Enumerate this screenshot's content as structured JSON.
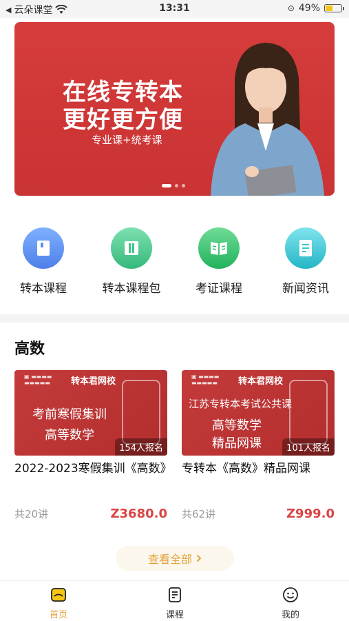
{
  "status_bar": {
    "carrier": "云朵课堂",
    "time": "13:31",
    "battery": "49%",
    "battery_level": 0.49
  },
  "banner": {
    "title_line1": "在线专转本",
    "title_line2": "更好更方便",
    "subtitle": "专业课+统考课",
    "slides": 3,
    "active_slide": 0
  },
  "quick_nav": [
    {
      "label": "转本课程",
      "icon": "book-icon",
      "color": "#5b8ef0"
    },
    {
      "label": "转本课程包",
      "icon": "package-icon",
      "color": "#3fc48c"
    },
    {
      "label": "考证课程",
      "icon": "open-book-icon",
      "color": "#2fc26b"
    },
    {
      "label": "新闻资讯",
      "icon": "document-icon",
      "color": "#36c6d3"
    }
  ],
  "section": {
    "title": "高数"
  },
  "courses": [
    {
      "brand": "转本君网校",
      "line1": "考前寒假集训",
      "line2": "高等数学",
      "enrolled": "154人报名",
      "title": "2022-2023寒假集训《高数》",
      "lessons": "共20讲",
      "price": "Z3680.0"
    },
    {
      "brand": "转本君网校",
      "line1": "江苏专转本考试公共课",
      "line2": "高等数学",
      "line3": "精品网课",
      "enrolled": "101人报名",
      "title": "专转本《高数》精品网课",
      "lessons": "共62讲",
      "price": "Z999.0"
    }
  ],
  "view_all": {
    "label": "查看全部",
    "icon": "chevron-right-icon"
  },
  "tab_bar": [
    {
      "label": "首页",
      "icon": "home-icon",
      "active": true
    },
    {
      "label": "课程",
      "icon": "course-icon",
      "active": false
    },
    {
      "label": "我的",
      "icon": "profile-icon",
      "active": false
    }
  ],
  "colors": {
    "accent": "#e6a23c",
    "price": "#d94545",
    "banner": "#d03838"
  }
}
